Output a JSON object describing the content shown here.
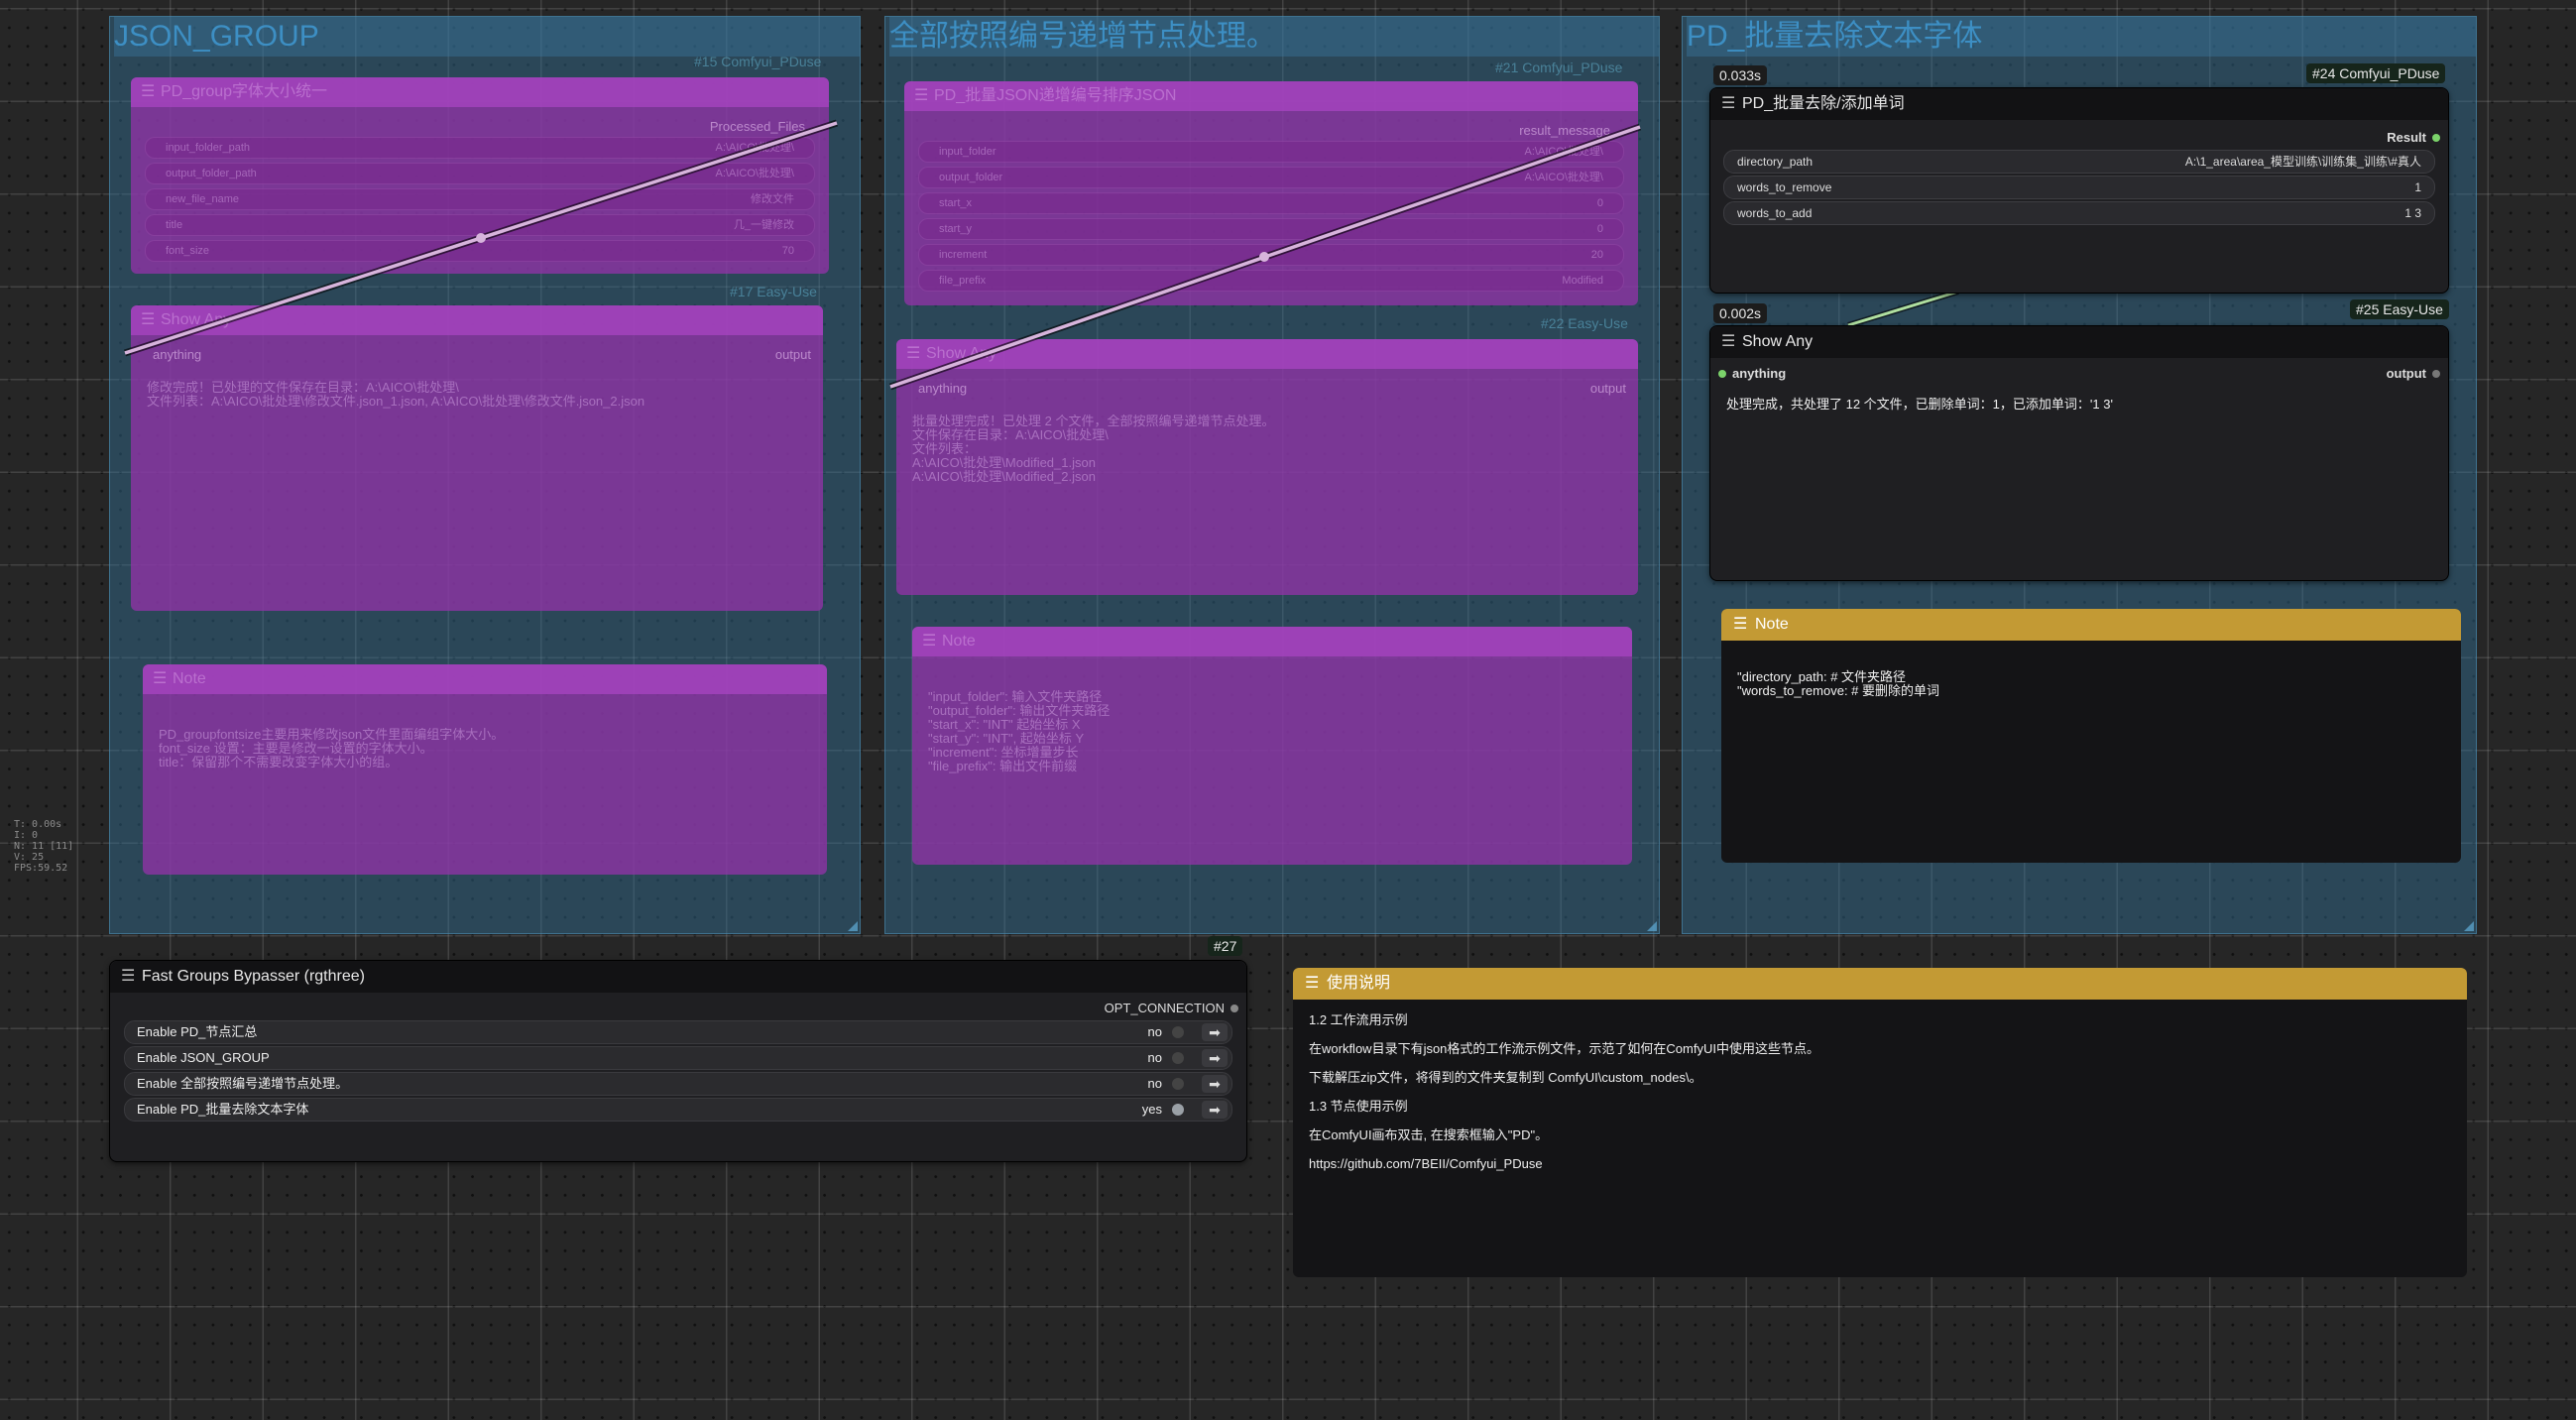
{
  "groups": [
    {
      "title": "JSON_GROUP"
    },
    {
      "title": "全部按照编号递增节点处理。"
    },
    {
      "title": "PD_批量去除文本字体"
    }
  ],
  "bypassed_nodes": {
    "group_font": {
      "tag": "#15 Comfyui_PDuse",
      "title": "PD_group字体大小统一",
      "output": "Processed_Files",
      "widgets": [
        {
          "label": "input_folder_path",
          "value": "A:\\AICO\\批处理\\"
        },
        {
          "label": "output_folder_path",
          "value": "A:\\AICO\\批处理\\"
        },
        {
          "label": "new_file_name",
          "value": "修改文件"
        },
        {
          "label": "title",
          "value": "几_一键修改"
        },
        {
          "label": "font_size",
          "value": "70"
        }
      ]
    },
    "show_any_1": {
      "tag": "#17 Easy-Use",
      "title": "Show Any",
      "input": "anything",
      "output": "output",
      "text": "修改完成！已处理的文件保存在目录：A:\\AICO\\批处理\\\n文件列表：A:\\AICO\\批处理\\修改文件.json_1.json, A:\\AICO\\批处理\\修改文件.json_2.json"
    },
    "note_1": {
      "title": "Note",
      "text": "PD_groupfontsize主要用来修改json文件里面编组字体大小。\nfont_size 设置：主要是修改一设置的字体大小。\ntitle：保留那个不需要改变字体大小的组。"
    },
    "json_sort": {
      "tag": "#21 Comfyui_PDuse",
      "title": "PD_批量JSON递增编号排序JSON",
      "output": "result_message",
      "widgets": [
        {
          "label": "input_folder",
          "value": "A:\\AICO\\批处理\\"
        },
        {
          "label": "output_folder",
          "value": "A:\\AICO\\批处理\\"
        },
        {
          "label": "start_x",
          "value": "0"
        },
        {
          "label": "start_y",
          "value": "0"
        },
        {
          "label": "increment",
          "value": "20"
        },
        {
          "label": "file_prefix",
          "value": "Modified"
        }
      ]
    },
    "show_any_2": {
      "tag": "#22 Easy-Use",
      "title": "Show Any",
      "input": "anything",
      "output": "output",
      "text": "批量处理完成！已处理 2 个文件，全部按照编号递增节点处理。\n文件保存在目录：A:\\AICO\\批处理\\\n文件列表：\nA:\\AICO\\批处理\\Modified_1.json\nA:\\AICO\\批处理\\Modified_2.json"
    },
    "note_2": {
      "title": "Note",
      "text": "\"input_folder\": 输入文件夹路径\n\"output_folder\": 输出文件夹路径\n\"start_x\": \"INT\" 起始坐标 X\n\"start_y\": \"INT\", 起始坐标 Y\n\"increment\": 坐标增量步长\n\"file_prefix\": 输出文件前缀"
    }
  },
  "active_nodes": {
    "batch_words": {
      "timing": "0.033s",
      "tag": "#24 Comfyui_PDuse",
      "title": "PD_批量去除/添加单词",
      "output": "Result",
      "widgets": [
        {
          "label": "directory_path",
          "value": "A:\\1_area\\area_模型训练\\训练集_训练\\#真人"
        },
        {
          "label": "words_to_remove",
          "value": "1"
        },
        {
          "label": "words_to_add",
          "value": "1 3"
        }
      ]
    },
    "show_any_3": {
      "timing": "0.002s",
      "tag": "#25 Easy-Use",
      "title": "Show Any",
      "input": "anything",
      "output": "output",
      "text": "处理完成，共处理了 12 个文件，已删除单词：1，已添加单词：'1 3'"
    },
    "note_3": {
      "title": "Note",
      "text": "\"directory_path: # 文件夹路径\n\"words_to_remove: # 要删除的单词"
    },
    "bypasser": {
      "tag": "#27",
      "title": "Fast Groups Bypasser (rgthree)",
      "output": "OPT_CONNECTION",
      "rows": [
        {
          "label": "Enable PD_节点汇总",
          "value": "no",
          "on": false
        },
        {
          "label": "Enable JSON_GROUP",
          "value": "no",
          "on": false
        },
        {
          "label": "Enable 全部按照编号递增节点处理。",
          "value": "no",
          "on": false
        },
        {
          "label": "Enable PD_批量去除文本字体",
          "value": "yes",
          "on": true
        }
      ]
    },
    "usage_note": {
      "title": "使用说明",
      "lines": [
        "1.2 工作流用示例",
        "在workflow目录下有json格式的工作流示例文件，示范了如何在ComfyUI中使用这些节点。",
        "下载解压zip文件，将得到的文件夹复制到 ComfyUI\\custom_nodes\\。",
        "1.3 节点使用示例",
        "在ComfyUI画布双击, 在搜索框输入\"PD\"。",
        "https://github.com/7BEII/Comfyui_PDuse"
      ]
    }
  },
  "stats": "T: 0.00s\nI: 0\nN: 11 [11]\nV: 25\nFPS:59.52",
  "icons": {
    "menu": "hamburger-icon",
    "goto": "arrow-right-icon"
  },
  "colors": {
    "bypass": "#9632aa",
    "group": "#3c82af",
    "note": "#c39a34",
    "link": "#b0e0a0"
  }
}
